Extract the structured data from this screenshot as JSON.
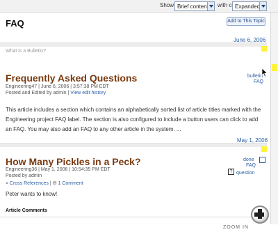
{
  "toolbar": {
    "show_label": "Show",
    "content_filter": "Brief content",
    "with_label": "with comments",
    "comments_mode": "Expanded"
  },
  "page": {
    "title": "FAQ",
    "add_to_topic": "Add to This Topic"
  },
  "posts": [
    {
      "date": "June 6, 2006",
      "prompt": "What is a Bulletin?",
      "title": "Frequently Asked Questions",
      "meta_line1": "Engineering47 | June 6, 2006 | 3:57:38 PM EDT",
      "meta_line2_prefix": "Posted and Edited by admin | ",
      "view_history": "View edit history",
      "body": "This article includes a section which contains an alphabetically sorted list of article titles marked with the Engineering project FAQ label. The section is also configured to include a button users can click to add an FAQ. You may also add an FAQ to any other article in the system. ...",
      "tags": [
        "bulletin",
        "FAQ"
      ]
    },
    {
      "date": "May 1, 2006",
      "title": "How Many Pickles in a Peck?",
      "meta_line1": "Engineering36 | May 1, 2006 | 10:54:35 PM EDT",
      "meta_line2": "Posted by admin",
      "cross_refs": "Cross References",
      "comment_count": "1 Comment",
      "body": "Peter wants to know!",
      "tags": [
        "done",
        "FAQ",
        "question"
      ]
    }
  ],
  "comments": {
    "heading": "Article Comments"
  },
  "zoom": {
    "label": "ZOOM IN",
    "icon": "plus-icon"
  },
  "icons": {
    "checkbox": "checkbox-icon",
    "question": "question-icon",
    "cursor": "pointer-cursor-icon"
  }
}
